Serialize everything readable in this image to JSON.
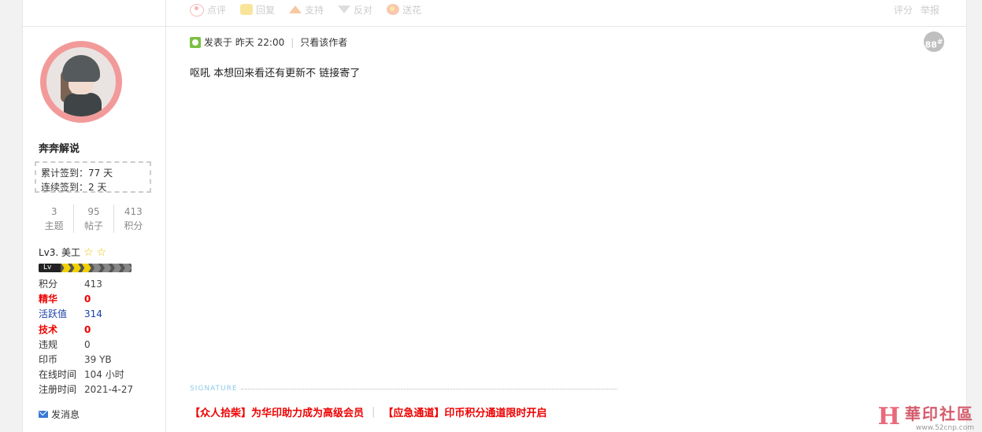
{
  "top_actions": [
    {
      "label": "点评",
      "icon": "eye-icon"
    },
    {
      "label": "回复",
      "icon": "speech-bubble-icon"
    },
    {
      "label": "支持",
      "icon": "thumbs-up-arrow-icon"
    },
    {
      "label": "反对",
      "icon": "thumbs-down-arrow-icon"
    },
    {
      "label": "送花",
      "icon": "flower-icon"
    }
  ],
  "top_right": {
    "rate": "评分",
    "report": "举报"
  },
  "user": {
    "name": "奔奔解说",
    "sign_total": "累计签到：77 天",
    "sign_streak": "连续签到：2 天",
    "stats": [
      {
        "value": "3",
        "label": "主题"
      },
      {
        "value": "95",
        "label": "帖子"
      },
      {
        "value": "413",
        "label": "积分"
      }
    ],
    "level": "Lv3. 美工",
    "level_badge": "Lv 3",
    "level_progress": 3,
    "level_total": 7,
    "info": [
      {
        "k": "积分",
        "v": "413",
        "style": ""
      },
      {
        "k": "精华",
        "v": "0",
        "style": "red"
      },
      {
        "k": "活跃值",
        "v": "314",
        "style": "blue"
      },
      {
        "k": "技术",
        "v": "0",
        "style": "red"
      },
      {
        "k": "违规",
        "v": "0",
        "style": ""
      },
      {
        "k": "印币",
        "v": "39 YB",
        "style": ""
      },
      {
        "k": "在线时间",
        "v": "104 小时",
        "style": ""
      },
      {
        "k": "注册时间",
        "v": "2021-4-27",
        "style": ""
      }
    ],
    "pm": "发消息"
  },
  "post": {
    "posted": "发表于 昨天 22:00",
    "only_author": "只看该作者",
    "floor": "88",
    "floor_mark": "#",
    "content": "呕吼 本想回来看还有更新不 链接寄了"
  },
  "signature": {
    "label": "SIGNATURE",
    "link1": "【众人拾柴】为华印助力成为高级会员",
    "link2": "【应急通道】印币积分通道限时开启"
  },
  "watermark": {
    "title": "華印社區",
    "url": "www.52cnp.com"
  }
}
